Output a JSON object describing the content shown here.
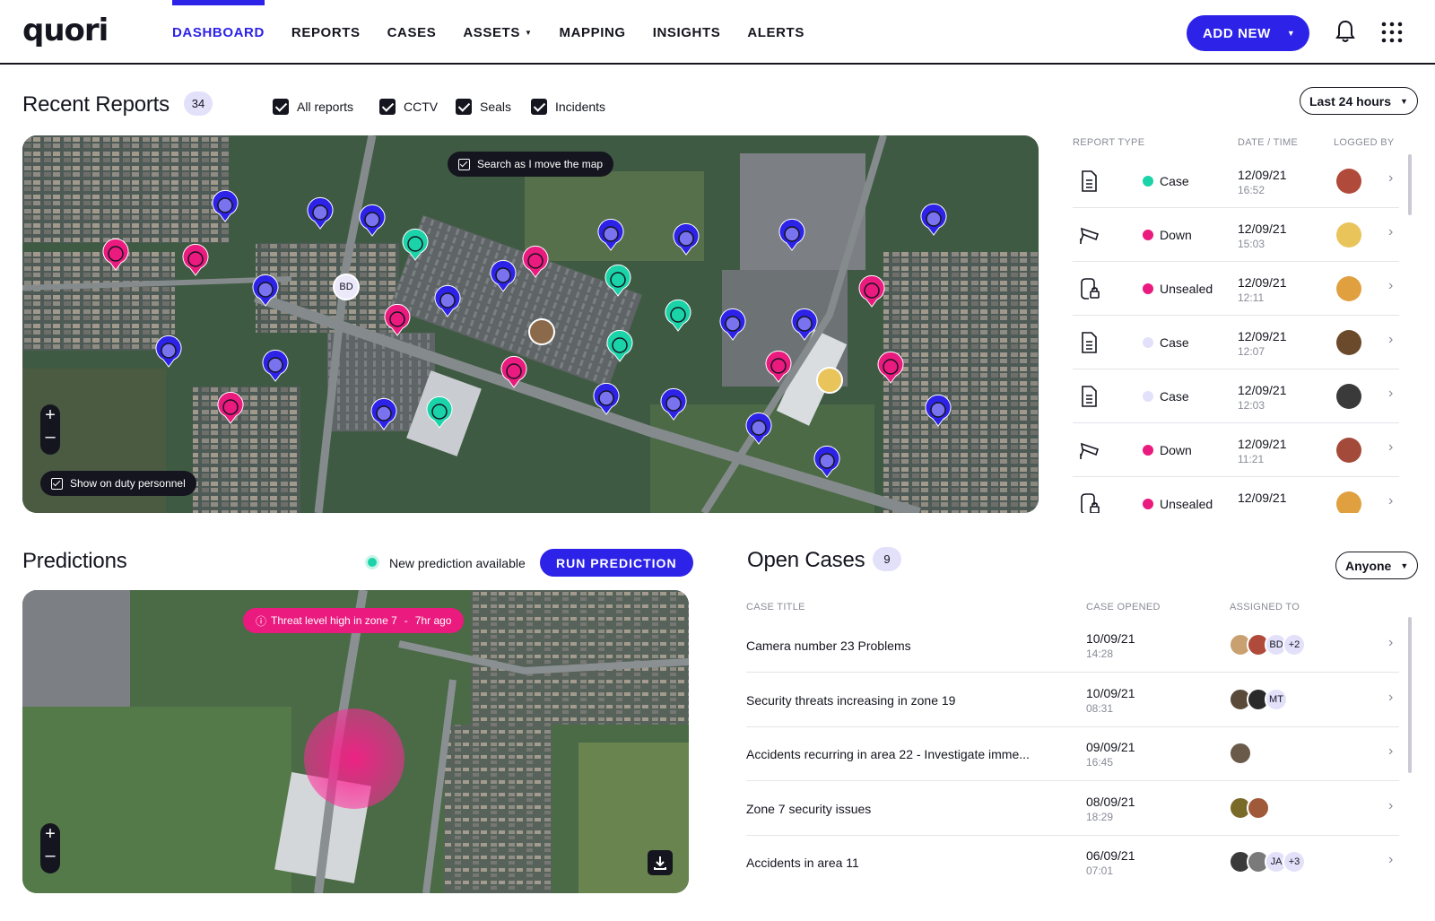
{
  "app": {
    "logo": "quori"
  },
  "nav": {
    "items": [
      {
        "label": "DASHBOARD",
        "active": true
      },
      {
        "label": "REPORTS"
      },
      {
        "label": "CASES"
      },
      {
        "label": "ASSETS",
        "dropdown": true
      },
      {
        "label": "MAPPING"
      },
      {
        "label": "INSIGHTS"
      },
      {
        "label": "ALERTS"
      }
    ],
    "add_new_label": "ADD NEW"
  },
  "colors": {
    "accent": "#2d22e8",
    "case": "#1bd3a8",
    "alert": "#ea1a7f",
    "dark": "#14151f",
    "muted_case": "#e3e0fa"
  },
  "icons": {
    "bell": "bell-icon",
    "apps": "grid-icon",
    "report": "document-icon",
    "cctv": "cctv-camera-icon",
    "seal": "seal-lock-icon"
  },
  "recent_reports": {
    "title": "Recent Reports",
    "count": "34",
    "filters": [
      {
        "label": "All reports",
        "checked": true
      },
      {
        "label": "CCTV",
        "checked": true
      },
      {
        "label": "Seals",
        "checked": true
      },
      {
        "label": "Incidents",
        "checked": true
      }
    ],
    "time_filter": "Last 24 hours",
    "map": {
      "search_toggle": "Search as I move the map",
      "duty_toggle": "Show on duty personnel",
      "zoom_in": "+",
      "zoom_out": "–",
      "marker_badge": "BD"
    },
    "columns": {
      "type": "REPORT TYPE",
      "date": "DATE / TIME",
      "logged": "LOGGED BY"
    },
    "rows": [
      {
        "icon": "document-icon",
        "status": "Case",
        "status_color": "#1bd3a8",
        "date": "12/09/21",
        "time": "16:52"
      },
      {
        "icon": "cctv-camera-icon",
        "status": "Down",
        "status_color": "#ea1a7f",
        "date": "12/09/21",
        "time": "15:03"
      },
      {
        "icon": "seal-lock-icon",
        "status": "Unsealed",
        "status_color": "#ea1a7f",
        "date": "12/09/21",
        "time": "12:11"
      },
      {
        "icon": "document-icon",
        "status": "Case",
        "status_color": "#e3e0fa",
        "date": "12/09/21",
        "time": "12:07"
      },
      {
        "icon": "document-icon",
        "status": "Case",
        "status_color": "#e3e0fa",
        "date": "12/09/21",
        "time": "12:03"
      },
      {
        "icon": "cctv-camera-icon",
        "status": "Down",
        "status_color": "#ea1a7f",
        "date": "12/09/21",
        "time": "11:21"
      },
      {
        "icon": "seal-lock-icon",
        "status": "Unsealed",
        "status_color": "#ea1a7f",
        "date": "12/09/21",
        "time": ""
      }
    ]
  },
  "predictions": {
    "title": "Predictions",
    "status": "New prediction available",
    "run_label": "RUN PREDICTION",
    "threat": "Threat level high in zone 7",
    "threat_sep": "-",
    "threat_age": "7hr ago",
    "zoom_in": "+",
    "zoom_out": "–"
  },
  "open_cases": {
    "title": "Open Cases",
    "count": "9",
    "assignee_filter": "Anyone",
    "columns": {
      "title": "CASE TITLE",
      "opened": "CASE OPENED",
      "assigned": "ASSIGNED TO"
    },
    "rows": [
      {
        "title": "Camera number 23 Problems",
        "date": "10/09/21",
        "time": "14:28",
        "avatars": 2,
        "initials": [
          "BD",
          "+2"
        ]
      },
      {
        "title": "Security threats increasing in zone 19",
        "date": "10/09/21",
        "time": "08:31",
        "avatars": 2,
        "initials": [
          "MT"
        ]
      },
      {
        "title": "Accidents recurring in area 22 - Investigate imme...",
        "date": "09/09/21",
        "time": "16:45",
        "avatars": 1,
        "initials": []
      },
      {
        "title": "Zone 7 security issues",
        "date": "08/09/21",
        "time": "18:29",
        "avatars": 2,
        "initials": []
      },
      {
        "title": "Accidents in area 11",
        "date": "06/09/21",
        "time": "07:01",
        "avatars": 2,
        "initials": [
          "JA",
          "+3"
        ]
      }
    ]
  }
}
